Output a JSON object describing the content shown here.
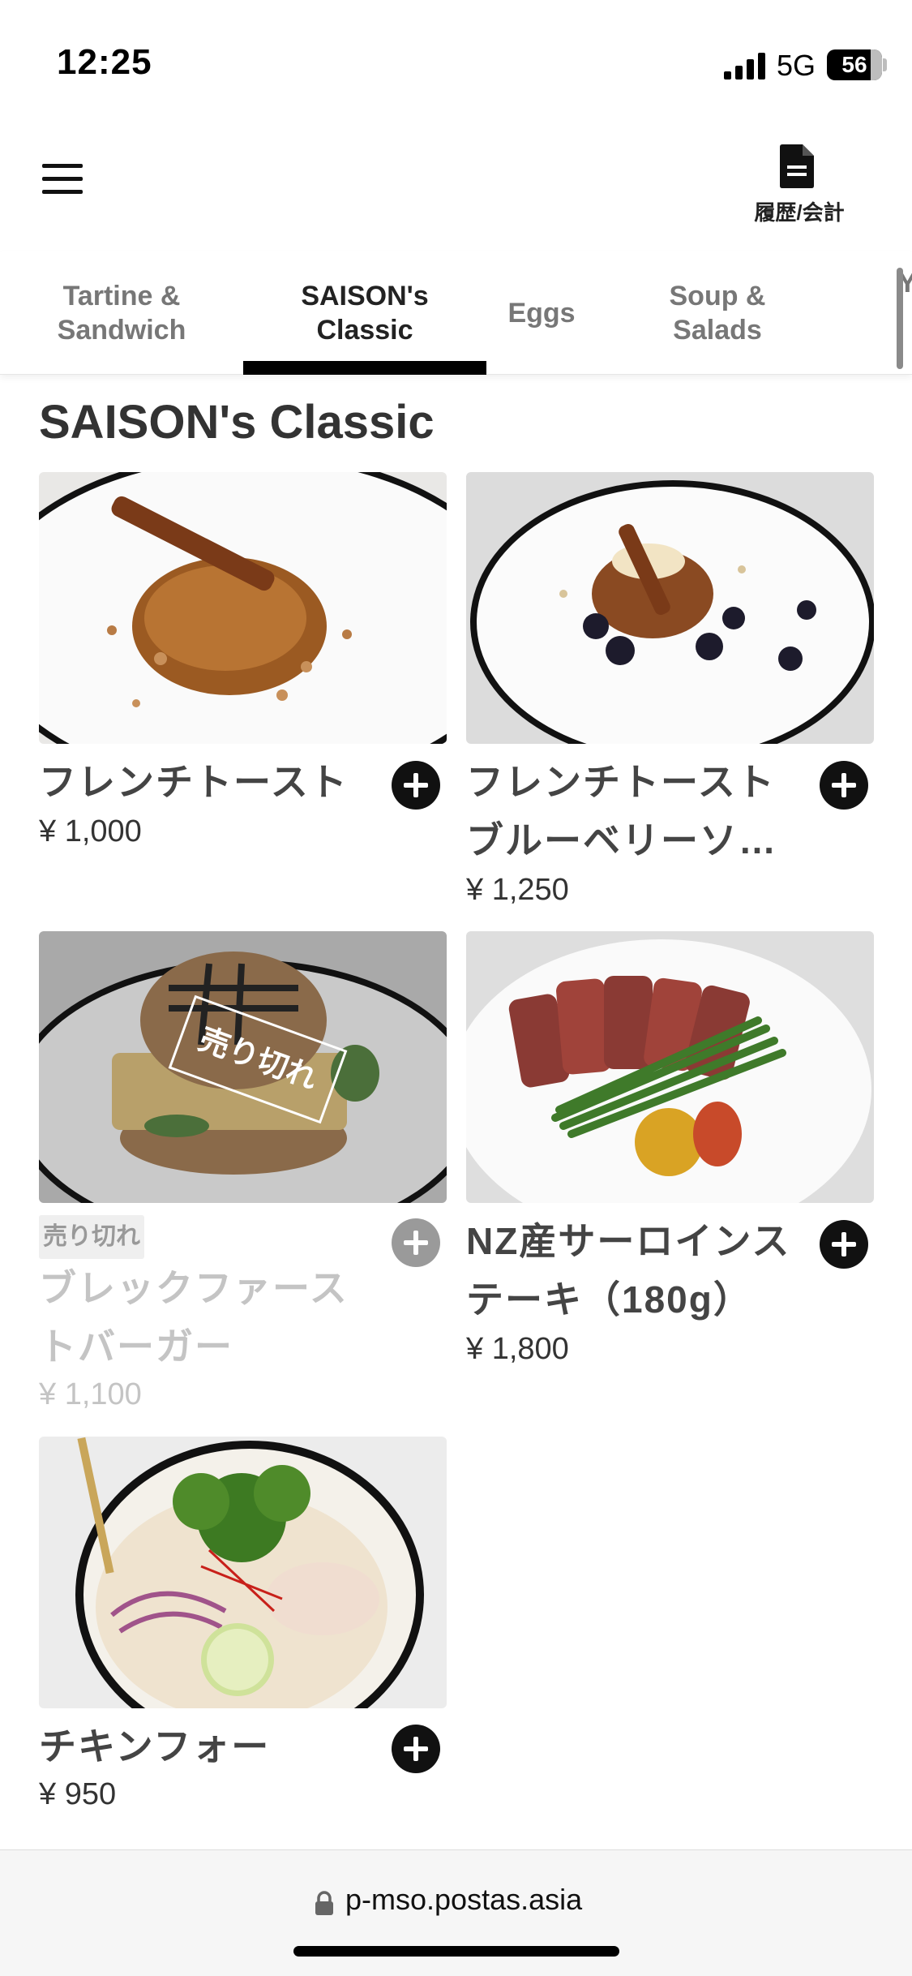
{
  "status_bar": {
    "time": "12:25",
    "network": "5G",
    "battery": "56"
  },
  "header": {
    "history_label": "履歴/会計"
  },
  "tabs": [
    {
      "label": "Tartine &\nSandwich"
    },
    {
      "label": "SAISON's\nClassic"
    },
    {
      "label": "Eggs"
    },
    {
      "label": "Soup &\nSalads"
    },
    {
      "label": "Y"
    }
  ],
  "section": {
    "title": "SAISON's Classic"
  },
  "items": [
    {
      "name_line1": "フレンチトースト",
      "name_line2": "",
      "price": "¥ 1,000",
      "sold_out": false
    },
    {
      "name_line1": "フレンチトースト",
      "name_line2": "ブルーベリーソ…",
      "price": "¥ 1,250",
      "sold_out": false
    },
    {
      "name_line1": "ブレックファース",
      "name_line2": "トバーガー",
      "price": "¥ 1,100",
      "sold_out": true,
      "badge": "売り切れ",
      "stamp": "売り切れ"
    },
    {
      "name_line1": "NZ産サーロインス",
      "name_line2": "テーキ（180g）",
      "price": "¥ 1,800",
      "sold_out": false
    },
    {
      "name_line1": "チキンフォー",
      "name_line2": "",
      "price": "¥ 950",
      "sold_out": false
    }
  ],
  "url_bar": {
    "url": "p-mso.postas.asia"
  },
  "colors": {
    "accent": "#000000",
    "disabled": "#9a9a9a",
    "muted_text": "#c4c4c4"
  }
}
